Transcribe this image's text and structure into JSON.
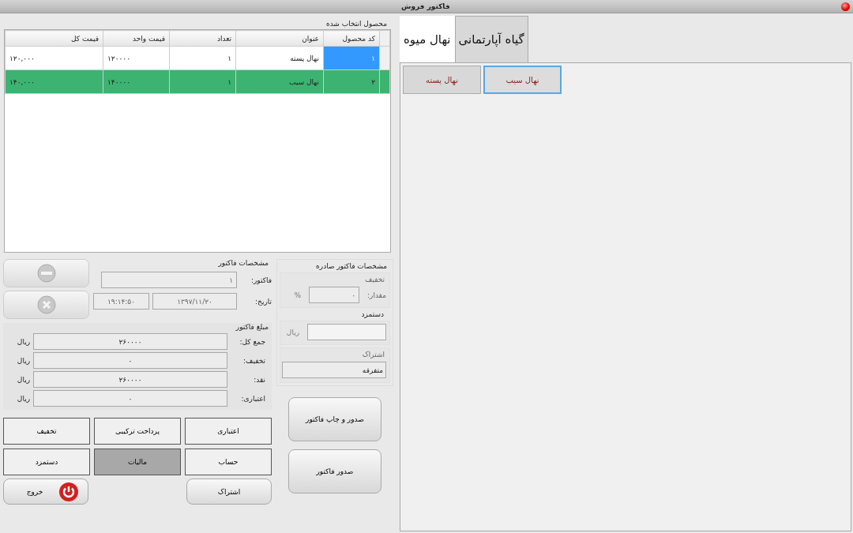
{
  "window": {
    "title": "فاکتور فروش"
  },
  "table": {
    "title": "محصول انتخاب شده",
    "columns": [
      "کد محصول",
      "عنوان",
      "تعداد",
      "قیمت واحد",
      "قیمت کل"
    ],
    "rows": [
      {
        "cells": [
          "۱",
          "نهال پسته",
          "۱",
          "۱۲۰۰۰۰",
          "۱۲۰,۰۰۰"
        ],
        "selected": false,
        "focused": true
      },
      {
        "cells": [
          "۲",
          "نهال سیب",
          "۱",
          "۱۴۰۰۰۰",
          "۱۴۰,۰۰۰"
        ],
        "selected": true,
        "focused": false
      }
    ]
  },
  "invoice": {
    "title": "مشخصات فاکتور",
    "number_label": "فاکتور:",
    "number": "۱",
    "date_label": "تاریخ:",
    "date": "۱۳۹۷/۱۱/۲۰",
    "time": "۱۹:۱۴:۵۰"
  },
  "amounts": {
    "title": "مبلغ فاکتور",
    "rows": [
      {
        "label": "جمع کل:",
        "value": "۲۶۰۰۰۰",
        "unit": "ریال"
      },
      {
        "label": "تخفیف:",
        "value": "۰",
        "unit": "ریال"
      },
      {
        "label": "نقد:",
        "value": "۲۶۰۰۰۰",
        "unit": "ریال"
      },
      {
        "label": "اعتباری:",
        "value": "۰",
        "unit": "ریال"
      }
    ]
  },
  "issued": {
    "title": "مشخصات فاکتور صادره",
    "discount_title": "تخفیف",
    "amount_label": "مقدار:",
    "amount": "۰",
    "percent": "%",
    "wage_title": "دستمزد",
    "wage_unit": "ریال",
    "share_title": "اشتراک",
    "share_value": "متفرقه"
  },
  "payment_buttons": [
    {
      "label": "اعتباری",
      "selected": false
    },
    {
      "label": "پرداخت ترکیبی",
      "selected": false
    },
    {
      "label": "تخفیف",
      "selected": false
    },
    {
      "label": "حساب",
      "selected": false
    },
    {
      "label": "مالیات",
      "selected": true
    },
    {
      "label": "دستمزد",
      "selected": false
    }
  ],
  "actions": [
    "صدور و چاپ فاکتور",
    "صدور فاکتور"
  ],
  "exit_button": "خروج",
  "share_button": "اشتراک",
  "tabs": [
    {
      "label": "گیاه آپارتمانی",
      "selected": false
    },
    {
      "label": "نهال میوه",
      "selected": true
    }
  ],
  "products": [
    {
      "label": "نهال سیب",
      "selected": true
    },
    {
      "label": "نهال پسته",
      "selected": false
    }
  ]
}
